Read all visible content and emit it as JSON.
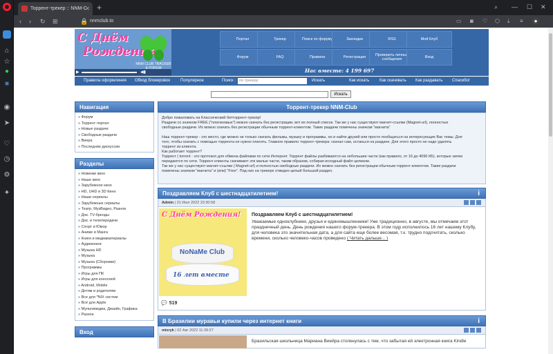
{
  "browser": {
    "tab_title": "Торрент-трекер :: NNM-C",
    "new_tab": "+",
    "url": "nnmclub.to",
    "window_controls": [
      "—",
      "☐",
      "✕"
    ]
  },
  "logo": {
    "line1": "С Днём",
    "line2": "Рождения!",
    "sub": "NNM CLUB\nTRACKER & FORUM"
  },
  "menu": [
    {
      "label": "Портал"
    },
    {
      "label": "Трекер"
    },
    {
      "label": "Поиск по форуму"
    },
    {
      "label": "Закладки"
    },
    {
      "label": "RSS"
    },
    {
      "label": "Мой Клуб"
    },
    {
      "label": "Форум"
    },
    {
      "label": "FAQ"
    },
    {
      "label": "Правила"
    },
    {
      "label": "Регистрация"
    },
    {
      "label": "Проверить личные сообщения"
    },
    {
      "label": "Вход"
    }
  ],
  "online": "Нас вместе: 4 199 697",
  "subnav": {
    "rules": "Правила оформления",
    "bypass": "Обход блокировок",
    "popular": "Популярное",
    "search_label": "Поиск :",
    "search_placeholder": "по трекеру",
    "search_button": "Искать",
    "howto_search": "Как искать",
    "howto_download": "Как скачивать",
    "howto_seed": "Как раздавать",
    "thanks": "Спасибо!"
  },
  "top_search": {
    "button": "Искать"
  },
  "navigation": {
    "title": "Навигация",
    "items": [
      "» Форум",
      "» Торрент портал",
      "» Новые раздачи",
      "» Свободные раздачи",
      "» Виера",
      "» Последние дискуссии"
    ]
  },
  "sections": {
    "title": "Разделы",
    "items": [
      "» Новинки кино",
      "» Наше кино",
      "» Зарубежное кино",
      "» HD, UHD и 3D Кино",
      "» Наши сериалы",
      "» Зарубежные сериалы",
      "» Театр, МузВидео, Разное",
      "» Док. TV-бренды",
      "» Док. и телепередачи",
      "» Спорт и Юмор",
      "» Аниме и Манга",
      "» Книги и медиаматериалы",
      "» Аудиокниги",
      "» Музыка HD",
      "» Музыка",
      "» Музыка (Сборники)",
      "» Программы",
      "» Игры для ПК",
      "» Игры для консолей",
      "» Android, Mobile",
      "» Детям и родителям",
      "» Все для *NIX систем",
      "» Всё для Apple",
      "» Мультимедиа, Дизайн, Графика",
      "» Разное"
    ]
  },
  "login": {
    "title": "Вход"
  },
  "main": {
    "title": "Торрент-трекер NNM-Club",
    "welcome": [
      "Добро пожаловать на Классический битторрент-трекер!",
      "Раздачи со значком FREE (\"платиновые\") можно скачать без регистрации, вот их полный список. Так же у нас существуют магнет-ссылки (Magnet-url), полностью",
      "свободные раздачи. Их можно скачать без регистрации обычным торрент-клиентом. Такие раздачи помечены значком \"магнита\"",
      "",
      "Наш торрент-трекер - это место, где можно не только скачать фильмы, музыку и программы, но и найти друзей или просто пообщаться на интересующие Вас темы. Для",
      "того, чтобы скачать с помощью торрента не нужно платить. Главное правило торрент-трекера: скачал сам, останься на раздаче. Для этого просто не надо удалять",
      "торрент из клиента.",
      "Как работает торрент?",
      "Торрент ( torrent - это протокол для обмена файлами по сети Интернет. Торрент файлы разбиваются на небольшие части (как правило, от 16 до 4096 КБ), которые затем",
      "передаются по сети. Торрент клиенты скачивают эти малые части, таким образом, собирая исходный файл целиком.",
      "Так же у нас существуют магнет-ссылки ( Magnet-url) и полностью свободные раздачи. Их можно скачать без регистрации обычным торрент-клиентом. Такие раздачи",
      "помечены значком \"магнита\" и (или) \"Free\". Под них на трекере отведен целый большой раздел."
    ]
  },
  "news": [
    {
      "heading": "Поздравляем Клуб с шестнадцатилетием!",
      "author": "Admin",
      "date": "31 Июл 2022 23:30:58",
      "title": "Поздравляем Клуб с шестнадцатилетием!",
      "text": "Уважаемые одноклубники, друзья и единомышленники! Уже традиционно, в августе, мы отмечаем этот праздничный день. День рождения нашего форум-трекера. В этом году исполнилось 16 лет нашему Клубу, для человека это значительная дата, а для сайта еще более весомая, т.к. трудно подсчитать, сколько времени, сколько человеко-часов проведено",
      "read_more": "( Читать дальше... )",
      "comments": "519",
      "image": {
        "title": "С Днём Рождения!",
        "club": "NoNaMe Club",
        "years": "16 лет вместе"
      }
    },
    {
      "heading": "В Бразилии муравьи купили через интернет книги",
      "author": "mixryk",
      "date": "02 Авг 2022 11:39:27",
      "text": "Бразильская школьница Мариана Виейра столкнулась с тем, что забытая ей электронная книга Kindle"
    }
  ]
}
